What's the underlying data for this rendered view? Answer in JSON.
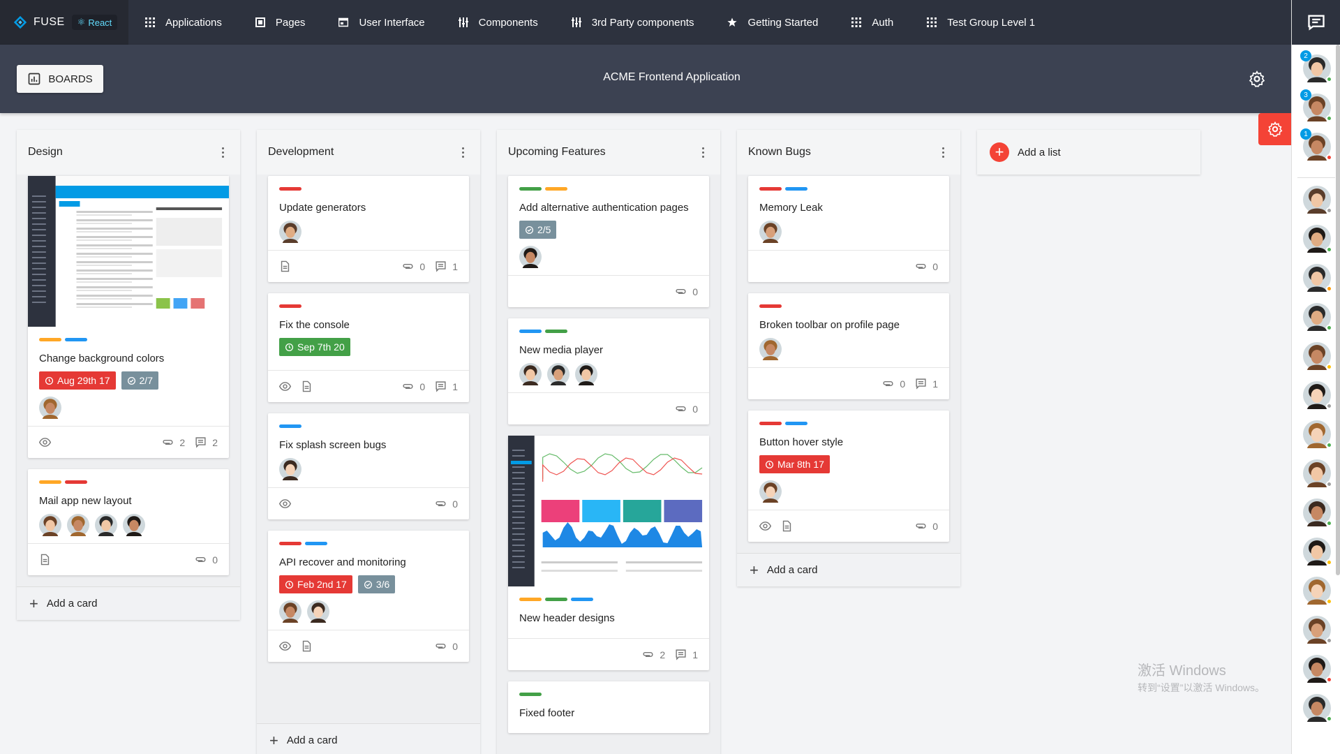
{
  "app": {
    "logo_text": "FUSE",
    "badge": "React"
  },
  "nav": [
    {
      "label": "Applications",
      "icon": "grid-icon"
    },
    {
      "label": "Pages",
      "icon": "pages-icon"
    },
    {
      "label": "User Interface",
      "icon": "web-icon"
    },
    {
      "label": "Components",
      "icon": "components-icon"
    },
    {
      "label": "3rd Party components",
      "icon": "components-icon"
    },
    {
      "label": "Getting Started",
      "icon": "star-icon"
    },
    {
      "label": "Auth",
      "icon": "grid-icon"
    },
    {
      "label": "Test Group Level 1",
      "icon": "grid-icon"
    }
  ],
  "header": {
    "boards_label": "BOARDS",
    "title": "ACME Frontend Application"
  },
  "colors": {
    "red": "#e53935",
    "blue": "#2196f3",
    "green": "#43a047",
    "orange": "#ffa726",
    "gray": "#78909c",
    "accent": "#f44336"
  },
  "lists": [
    {
      "name": "Design",
      "add_card": "Add a card",
      "cards": [
        {
          "image": true,
          "labels": [
            "orange",
            "blue"
          ],
          "title": "Change background colors",
          "due": "Aug 29th 17",
          "due_color": "red",
          "checklist": "2/7",
          "members": 1,
          "subscribed": true,
          "description": false,
          "attachments": "2",
          "comments": "2"
        },
        {
          "labels": [
            "orange",
            "red"
          ],
          "title": "Mail app new layout",
          "members": 4,
          "subscribed": false,
          "description": true,
          "attachments": "0"
        }
      ]
    },
    {
      "name": "Development",
      "add_card": "Add a card",
      "cards": [
        {
          "labels": [
            "red"
          ],
          "title": "Update generators",
          "members": 1,
          "description": true,
          "attachments": "0",
          "comments": "1"
        },
        {
          "labels": [
            "red"
          ],
          "title": "Fix the console",
          "due": "Sep 7th 20",
          "due_color": "green",
          "members": 0,
          "subscribed": true,
          "description": true,
          "attachments": "0",
          "comments": "1"
        },
        {
          "labels": [
            "blue"
          ],
          "title": "Fix splash screen bugs",
          "members": 1,
          "subscribed": true,
          "attachments": "0"
        },
        {
          "labels": [
            "red",
            "blue"
          ],
          "title": "API recover and monitoring",
          "due": "Feb 2nd 17",
          "due_color": "red",
          "checklist": "3/6",
          "members": 2,
          "subscribed": true,
          "description": true,
          "attachments": "0"
        }
      ]
    },
    {
      "name": "Upcoming Features",
      "add_card": "Add a card",
      "cards": [
        {
          "labels": [
            "green",
            "orange"
          ],
          "title": "Add alternative authentication pages",
          "checklist": "2/5",
          "members": 1,
          "attachments": "0"
        },
        {
          "labels": [
            "blue",
            "green"
          ],
          "title": "New media player",
          "members": 3,
          "attachments": "0"
        },
        {
          "image": true,
          "labels": [
            "orange",
            "green",
            "blue"
          ],
          "title": "New header designs",
          "members": 0,
          "attachments": "2",
          "comments": "1"
        },
        {
          "labels": [
            "green"
          ],
          "title": "Fixed footer",
          "members": 0
        }
      ]
    },
    {
      "name": "Known Bugs",
      "add_card": "Add a card",
      "cards": [
        {
          "labels": [
            "red",
            "blue"
          ],
          "title": "Memory Leak",
          "members": 1,
          "attachments": "0"
        },
        {
          "labels": [
            "red"
          ],
          "title": "Broken toolbar on profile page",
          "members": 1,
          "attachments": "0",
          "comments": "1"
        },
        {
          "labels": [
            "red",
            "blue"
          ],
          "title": "Button hover style",
          "due": "Mar 8th 17",
          "due_color": "red",
          "members": 1,
          "subscribed": true,
          "description": true,
          "attachments": "0"
        }
      ]
    }
  ],
  "add_list": "Add a list",
  "watermark": {
    "line1": "激活 Windows",
    "line2": "转到“设置”以激活 Windows。"
  },
  "contacts": [
    {
      "unread": "2",
      "status": "#4caf50"
    },
    {
      "unread": "3",
      "status": "#4caf50"
    },
    {
      "unread": "1",
      "status": "#f44336"
    },
    {
      "status": "#9e9e9e"
    },
    {
      "status": "#4caf50"
    },
    {
      "status": "#ff9800"
    },
    {
      "status": "#4caf50"
    },
    {
      "status": "#ffc107"
    },
    {
      "status": "#9e9e9e"
    },
    {
      "status": "#4caf50"
    },
    {
      "status": "#9e9e9e"
    },
    {
      "status": "#4caf50"
    },
    {
      "status": "#ffc107"
    },
    {
      "status": "#ffc107"
    },
    {
      "status": "#9e9e9e"
    },
    {
      "status": "#f44336"
    },
    {
      "status": "#4caf50"
    }
  ]
}
